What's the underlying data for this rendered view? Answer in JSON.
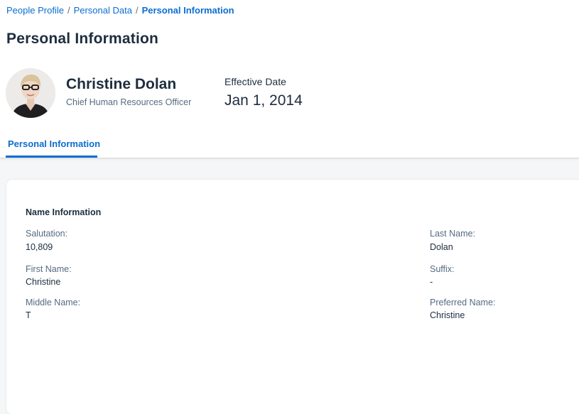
{
  "breadcrumb": {
    "items": [
      "People Profile",
      "Personal Data"
    ],
    "separator": "/",
    "current": "Personal Information"
  },
  "page": {
    "title": "Personal Information"
  },
  "profile": {
    "name": "Christine Dolan",
    "role": "Chief Human Resources Officer",
    "effective_date_label": "Effective Date",
    "effective_date_value": "Jan 1, 2014"
  },
  "tabs": [
    {
      "label": "Personal Information",
      "selected": true
    }
  ],
  "section": {
    "title": "Name Information",
    "left_fields": [
      {
        "label": "Salutation:",
        "value": "10,809"
      },
      {
        "label": "First Name:",
        "value": "Christine"
      },
      {
        "label": "Middle Name:",
        "value": "T"
      }
    ],
    "right_fields": [
      {
        "label": "Last Name:",
        "value": "Dolan"
      },
      {
        "label": "Suffix:",
        "value": "-"
      },
      {
        "label": "Preferred Name:",
        "value": "Christine"
      }
    ]
  },
  "colors": {
    "accent": "#0a6ed1",
    "text": "#1d2d3e",
    "label": "#556b82",
    "background": "#f5f6f7"
  }
}
